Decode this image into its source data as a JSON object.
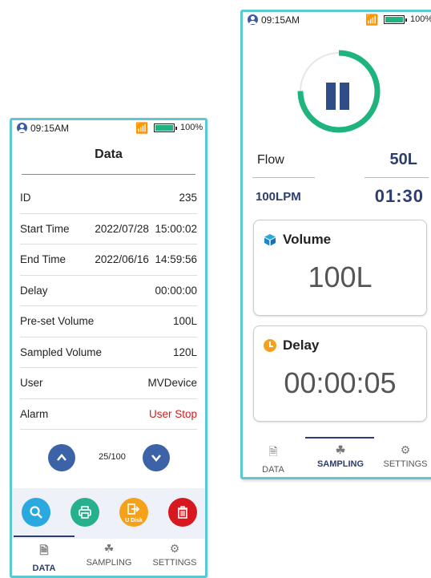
{
  "status": {
    "time": "09:15AM",
    "battery": "100%",
    "wifi_icon": "wifi-icon"
  },
  "data_screen": {
    "title": "Data",
    "rows": [
      {
        "label": "ID",
        "value": "235"
      },
      {
        "label": "Start Time",
        "value": "2022/07/28  15:00:02"
      },
      {
        "label": "End Time",
        "value": "2022/06/16  14:59:56"
      },
      {
        "label": "Delay",
        "value": "00:00:00"
      },
      {
        "label": "Pre-set Volume",
        "value": "100L"
      },
      {
        "label": "Sampled Volume",
        "value": "120L"
      },
      {
        "label": "User",
        "value": "MVDevice"
      },
      {
        "label": "Alarm",
        "value": "User Stop"
      }
    ],
    "pager": {
      "count": "25/100"
    },
    "actions": {
      "udisk_label": "U Disk"
    }
  },
  "sampling_screen": {
    "flow_label": "Flow",
    "flow_value": "50L",
    "rate": "100LPM",
    "timer": "01:30",
    "progress": 0.75,
    "volume": {
      "title": "Volume",
      "value": "100L"
    },
    "delay": {
      "title": "Delay",
      "value": "00:00:05"
    }
  },
  "tabs": [
    "DATA",
    "SAMPLING",
    "SETTINGS"
  ],
  "colors": {
    "accent": "#2c3e6f",
    "ring": "#1fb47e",
    "frame": "#5bc8d4",
    "alarm": "#d81b1b"
  }
}
